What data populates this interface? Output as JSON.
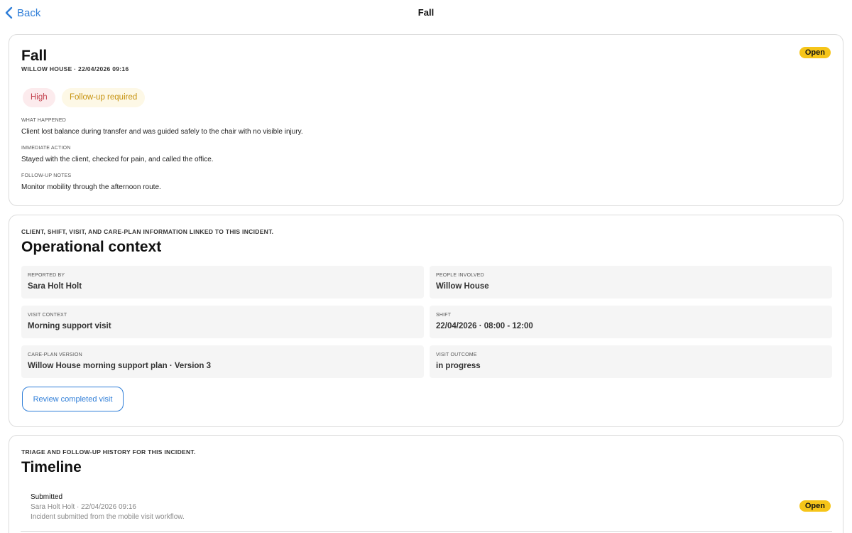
{
  "nav": {
    "back_label": "Back",
    "title": "Fall"
  },
  "incident": {
    "title": "Fall",
    "meta": "WILLOW HOUSE · 22/04/2026 09:16",
    "status": "Open",
    "chips": {
      "severity": "High",
      "follow_up": "Follow-up required"
    },
    "fields": [
      {
        "label": "WHAT HAPPENED",
        "value": "Client lost balance during transfer and was guided safely to the chair with no visible injury."
      },
      {
        "label": "IMMEDIATE ACTION",
        "value": "Stayed with the client, checked for pain, and called the office."
      },
      {
        "label": "FOLLOW-UP NOTES",
        "value": "Monitor mobility through the afternoon route."
      }
    ]
  },
  "context": {
    "subtitle": "CLIENT, SHIFT, VISIT, AND CARE-PLAN INFORMATION LINKED TO THIS INCIDENT.",
    "title": "Operational context",
    "cells": [
      {
        "label": "REPORTED BY",
        "value": "Sara Holt Holt"
      },
      {
        "label": "PEOPLE INVOLVED",
        "value": "Willow House"
      },
      {
        "label": "VISIT CONTEXT",
        "value": "Morning support visit"
      },
      {
        "label": "SHIFT",
        "value": "22/04/2026 · 08:00 - 12:00"
      },
      {
        "label": "CARE-PLAN VERSION",
        "value": "Willow House morning support plan · Version 3"
      },
      {
        "label": "VISIT OUTCOME",
        "value": "in progress"
      }
    ],
    "review_button": "Review completed visit"
  },
  "timeline": {
    "subtitle": "TRIAGE AND FOLLOW-UP HISTORY FOR THIS INCIDENT.",
    "title": "Timeline",
    "items": [
      {
        "title": "Submitted",
        "meta": "Sara Holt Holt · 22/04/2026 09:16",
        "note": "Incident submitted from the mobile visit workflow.",
        "status": "Open"
      }
    ]
  },
  "colors": {
    "accent": "#2f7ed8",
    "open_badge": "#f6c519",
    "high_chip_bg": "#fcebed",
    "high_chip_text": "#c4434f",
    "follow_chip_bg": "#fdf8e6",
    "follow_chip_text": "#c6920e"
  },
  "icons": {
    "back": "chevron-left-icon"
  }
}
